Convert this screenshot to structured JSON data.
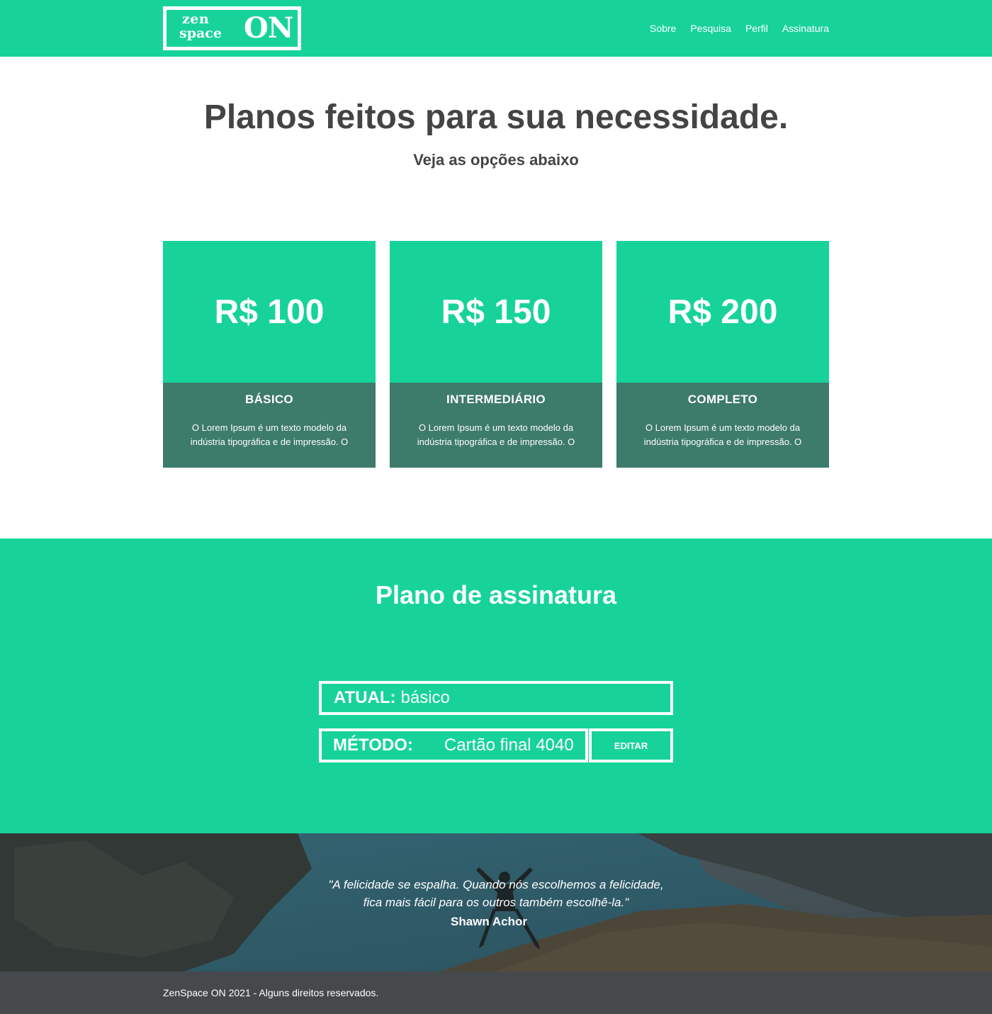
{
  "header": {
    "logo": {
      "line1": "zen",
      "line2": "space",
      "mark": "ON"
    },
    "nav": [
      "Sobre",
      "Pesquisa",
      "Perfil",
      "Assinatura"
    ]
  },
  "hero": {
    "title": "Planos feitos para sua necessidade.",
    "subtitle": "Veja as opções abaixo"
  },
  "plans": [
    {
      "price": "R$ 100",
      "name": "BÁSICO",
      "description": "O Lorem Ipsum é um texto modelo da indústria tipográfica e de impressão. O"
    },
    {
      "price": "R$ 150",
      "name": "INTERMEDIÁRIO",
      "description": "O Lorem Ipsum é um texto modelo da indústria tipográfica e de impressão. O"
    },
    {
      "price": "R$ 200",
      "name": "COMPLETO",
      "description": "O Lorem Ipsum é um texto modelo da indústria tipográfica e de impressão. O"
    }
  ],
  "subscription": {
    "title": "Plano de assinatura",
    "current_label": "ATUAL:",
    "current_value": "básico",
    "method_label": "MÉTODO:",
    "method_value": "Cartão final 4040",
    "edit_label": "EDITAR"
  },
  "quote": {
    "line1": "\"A felicidade se espalha. Quando nós escolhemos a felicidade,",
    "line2": "fica mais fácil para os outros também escolhê-la.\"",
    "author": "Shawn Achor"
  },
  "footer": {
    "text": "ZenSpace ON 2021 - Alguns direitos reservados."
  },
  "colors": {
    "accent": "#17d39a",
    "card_bottom": "#3d7b6b",
    "text_dark": "#444444",
    "footer_bg": "#45494c"
  }
}
